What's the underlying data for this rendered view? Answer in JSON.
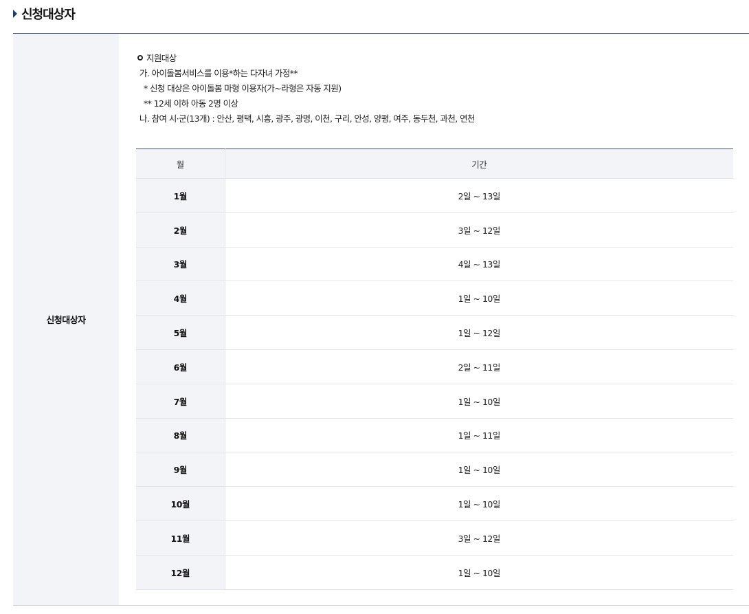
{
  "section": {
    "title": "신청대상자"
  },
  "frame": {
    "label": "신청대상자"
  },
  "info": {
    "heading": "지원대상",
    "line_a": "가. 아이돌봄서비스를 이용*하는 다자녀 가정**",
    "note_1": "* 신청 대상은 아이돌봄 마형 이용자(가~라형은 자동 지원)",
    "note_2": "** 12세 이하 아동 2명 이상",
    "line_b": "나. 참여 시·군(13개) : 안산, 평택, 시흥, 광주, 광명, 이천, 구리, 안성, 양평, 여주, 동두천, 과천, 연천"
  },
  "table": {
    "headers": {
      "month": "월",
      "period": "기간"
    },
    "rows": [
      {
        "month": "1월",
        "period": "2일 ~ 13일"
      },
      {
        "month": "2월",
        "period": "3일 ~ 12일"
      },
      {
        "month": "3월",
        "period": "4일 ~ 13일"
      },
      {
        "month": "4월",
        "period": "1일 ~ 10일"
      },
      {
        "month": "5월",
        "period": "1일 ~ 12일"
      },
      {
        "month": "6월",
        "period": "2일 ~ 11일"
      },
      {
        "month": "7월",
        "period": "1일 ~ 10일"
      },
      {
        "month": "8월",
        "period": "1일 ~ 11일"
      },
      {
        "month": "9월",
        "period": "1일 ~ 10일"
      },
      {
        "month": "10월",
        "period": "1일 ~ 10일"
      },
      {
        "month": "11월",
        "period": "3일 ~ 12일"
      },
      {
        "month": "12월",
        "period": "1일 ~ 10일"
      }
    ]
  },
  "colors": {
    "accent": "#1f3d7a",
    "header_bg": "#f3f4f7",
    "border": "#e3e5ea"
  }
}
